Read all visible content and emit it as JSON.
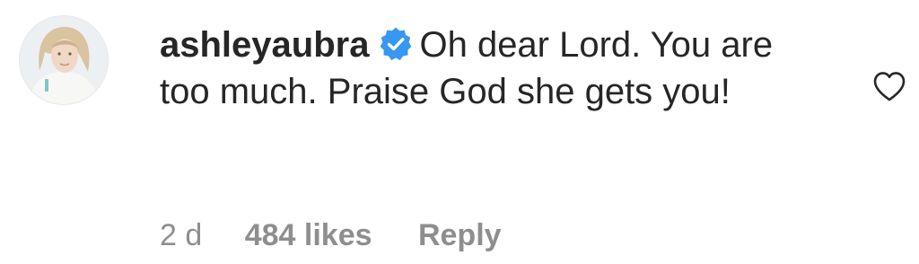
{
  "comment": {
    "username": "ashleyaubra",
    "verified_icon": "verified-badge-icon",
    "verified_color": "#3897f0",
    "text": "Oh dear Lord. You are too much. Praise God she gets you!",
    "timestamp": "2 d",
    "likes": "484 likes",
    "reply_label": "Reply",
    "like_icon": "heart-outline-icon",
    "avatar_icon": "avatar"
  },
  "colors": {
    "primary_text": "#262626",
    "secondary_text": "#8e8e8e",
    "background": "#ffffff"
  }
}
